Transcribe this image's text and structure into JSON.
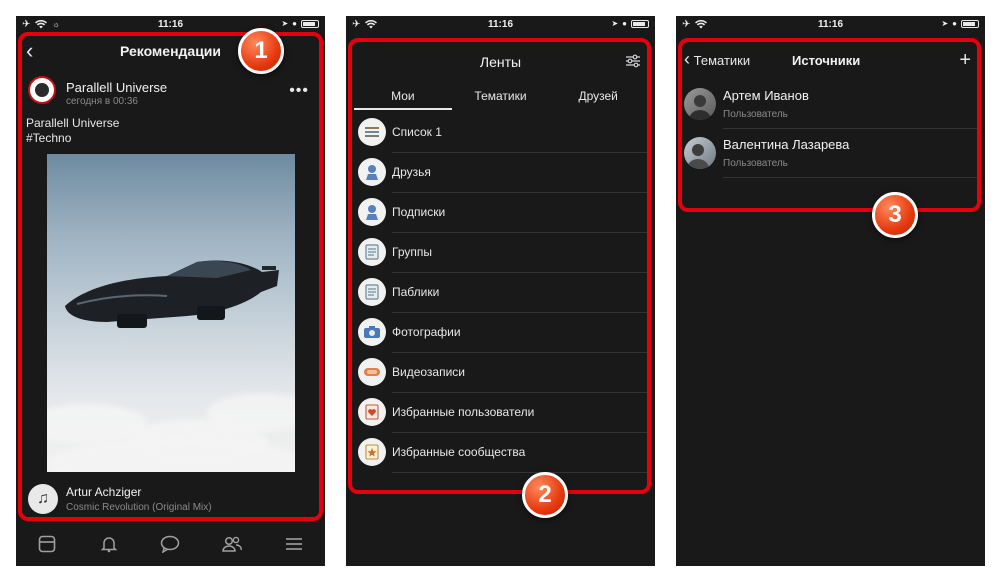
{
  "status": {
    "time": "11:16"
  },
  "screen1": {
    "title": "Рекомендации",
    "post": {
      "author": "Parallell Universe",
      "time": "сегодня в 00:36",
      "text_line1": "Parallell Universe",
      "text_line2": "#Techno"
    },
    "music": {
      "artist": "Artur Achziger",
      "track": "Cosmic Revolution (Original Mix)"
    },
    "tabbar": [
      "news-icon",
      "bell-icon",
      "chat-icon",
      "friends-icon",
      "menu-icon"
    ],
    "badge": "1"
  },
  "screen2": {
    "title": "Ленты",
    "tabs": [
      "Мои",
      "Тематики",
      "Друзей"
    ],
    "items": [
      {
        "label": "Список 1",
        "icon": "list-icon"
      },
      {
        "label": "Друзья",
        "icon": "friend-icon"
      },
      {
        "label": "Подписки",
        "icon": "subscription-icon"
      },
      {
        "label": "Группы",
        "icon": "group-icon"
      },
      {
        "label": "Паблики",
        "icon": "public-icon"
      },
      {
        "label": "Фотографии",
        "icon": "camera-icon"
      },
      {
        "label": "Видеозаписи",
        "icon": "video-icon"
      },
      {
        "label": "Избранные пользователи",
        "icon": "favorite-users-icon"
      },
      {
        "label": "Избранные сообщества",
        "icon": "favorite-communities-icon"
      }
    ],
    "badge": "2"
  },
  "screen3": {
    "back_label": "Тематики",
    "title": "Источники",
    "plus": "+",
    "items": [
      {
        "name": "Артем Иванов",
        "role": "Пользователь"
      },
      {
        "name": "Валентина Лазарева",
        "role": "Пользователь"
      }
    ],
    "badge": "3"
  },
  "colors": {
    "highlight": "#e4000f",
    "badge": "#e63a10",
    "background": "#191919"
  }
}
